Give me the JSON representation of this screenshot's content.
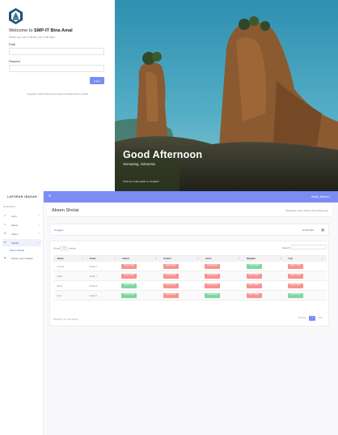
{
  "login": {
    "welcome_prefix": "Welcome to ",
    "school_name": "SMP-IT Bina Amal",
    "subtitle": "Before you can continue, you must login.",
    "email_label": "Email",
    "email_value": "",
    "password_label": "Password",
    "password_value": "",
    "login_button": "Login",
    "copyright_prefix": "Copyright © 2019  IT Bina Amal | Inspired and Made with ",
    "copyright_suffix": " by TEAM",
    "greeting": "Good Afternoon",
    "location": "Semarang, Indonesia",
    "photo_credit": "Photo by Yudha Aprilia on Unsplash"
  },
  "admin": {
    "brand": "LAPORAN IBADAH",
    "user_menu": "Admin_Ibadah ▾",
    "sidebar": {
      "heading": "Dashboard",
      "items": [
        {
          "label": "Guru",
          "icon": "user-icon"
        },
        {
          "label": "Siswa",
          "icon": "users-icon"
        },
        {
          "label": "Absen",
          "icon": "clipboard-icon"
        },
        {
          "label": "Ibadah",
          "icon": "book-icon"
        },
        {
          "label": "Kelola Login Ibadah",
          "icon": "key-icon"
        }
      ],
      "sub_item": "Absen Sholat"
    },
    "page_title": "Absen Sholat",
    "breadcrumb": "Dashboard / Absen Sholat / Absen Berjemaah",
    "filter_label": "Tanggal :",
    "date_value": "22-08-2019",
    "show_label": "Show",
    "entries_value": "10",
    "entries_label": "entries",
    "search_label": "Search:",
    "columns": [
      "Nama",
      "Kelas",
      "Subuh",
      "Dzuhur",
      "Ashar",
      "Maghrib",
      "Isya"
    ],
    "rows": [
      {
        "name": "Ammar",
        "kelas": "Kelas 7",
        "status": [
          "Belum Hadir",
          "Belum Hadir",
          "Belum Hadir",
          "Sudah Hadir",
          "Belum Hadir"
        ]
      },
      {
        "name": "Azka",
        "kelas": "Kelas 7",
        "status": [
          "Belum Hadir",
          "Belum Hadir",
          "Belum Hadir",
          "Belum Hadir",
          "Belum Hadir"
        ]
      },
      {
        "name": "Bima",
        "kelas": "Kelas 8",
        "status": [
          "Sudah Hadir",
          "Belum Hadir",
          "Belum Hadir",
          "Belum Hadir",
          "Belum Hadir"
        ]
      },
      {
        "name": "Faiz",
        "kelas": "Kelas 9",
        "status": [
          "Sudah Hadir",
          "Belum Hadir",
          "Sudah Hadir",
          "Belum Hadir",
          "Sudah Hadir"
        ]
      }
    ],
    "showing": "Showing 1 to 4 of 4 entries",
    "prev": "Previous",
    "page": "1",
    "next": "Next"
  }
}
